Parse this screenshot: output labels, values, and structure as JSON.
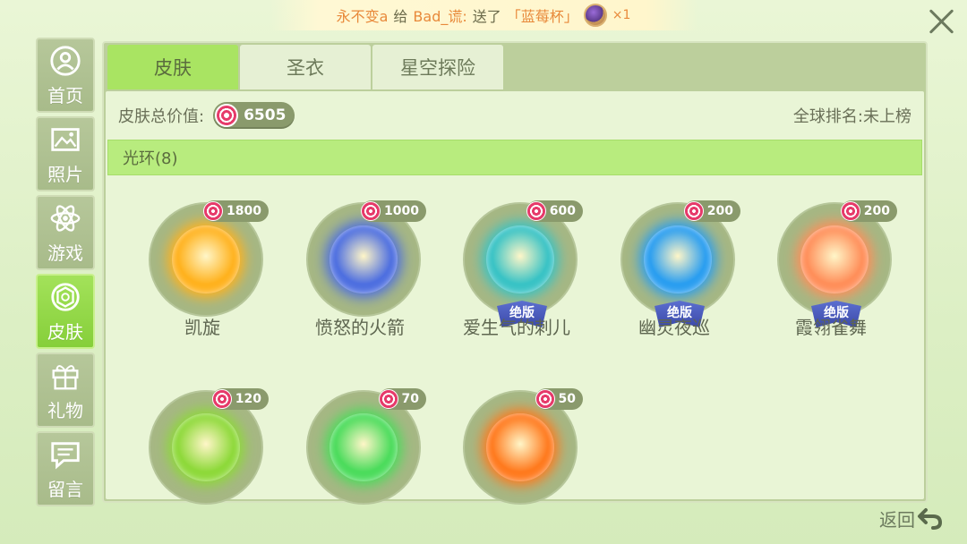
{
  "banner": {
    "sender": "永不变a",
    "verb1": "给",
    "receiver": "Bad_谎:",
    "verb2": "送了",
    "gift_name": "「蓝莓杯」",
    "count": "×1"
  },
  "sidebar": {
    "items": [
      {
        "label": "首页",
        "icon": "home-icon"
      },
      {
        "label": "照片",
        "icon": "photo-icon"
      },
      {
        "label": "游戏",
        "icon": "atom-icon"
      },
      {
        "label": "皮肤",
        "icon": "skin-icon",
        "active": true
      },
      {
        "label": "礼物",
        "icon": "gift-icon"
      },
      {
        "label": "留言",
        "icon": "message-icon"
      }
    ]
  },
  "tabs": [
    {
      "label": "皮肤",
      "active": true
    },
    {
      "label": "圣衣",
      "active": false
    },
    {
      "label": "星空探险",
      "active": false
    }
  ],
  "summary": {
    "value_label": "皮肤总价值:",
    "value": "6505",
    "rank_label": "全球排名:未上榜"
  },
  "section": {
    "title": "光环(8)"
  },
  "items": [
    {
      "name": "凯旋",
      "price": "1800",
      "limited": false,
      "color": "#ffb21e"
    },
    {
      "name": "愤怒的火箭",
      "price": "1000",
      "limited": false,
      "color": "#4e6fe0"
    },
    {
      "name": "爱生气的刺儿",
      "price": "600",
      "limited": true,
      "color": "#39c3c5"
    },
    {
      "name": "幽灵夜巡",
      "price": "200",
      "limited": true,
      "color": "#2a9ef0"
    },
    {
      "name": "霞翎雀舞",
      "price": "200",
      "limited": true,
      "color": "#ff8f5a"
    },
    {
      "name": "",
      "price": "120",
      "limited": false,
      "color": "#8ed93a"
    },
    {
      "name": "",
      "price": "70",
      "limited": false,
      "color": "#4cdc5c"
    },
    {
      "name": "",
      "price": "50",
      "limited": false,
      "color": "#ff7a1e"
    }
  ],
  "badge_label": "绝版",
  "back_label": "返回"
}
